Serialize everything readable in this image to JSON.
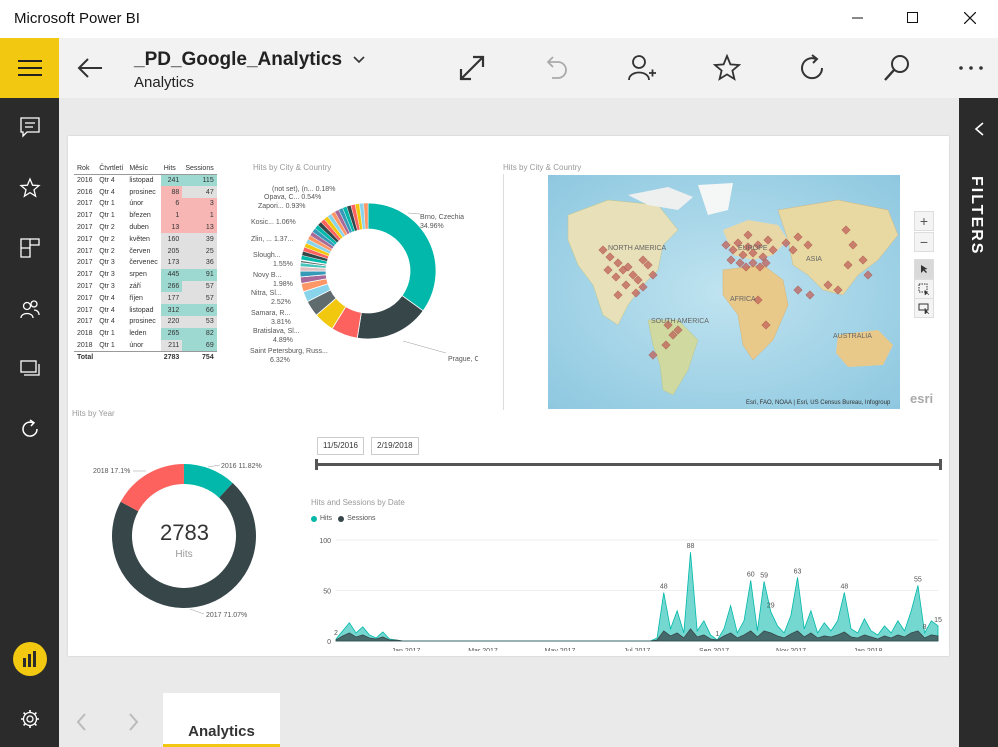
{
  "window": {
    "title": "Microsoft Power BI",
    "minimize_icon": "minimize-icon",
    "maximize_icon": "maximize-icon",
    "close_icon": "close-icon"
  },
  "topbar": {
    "dashboard_name": "_PD_Google_Analytics",
    "subtitle": "Analytics",
    "buttons": [
      "back-icon",
      "expand-icon",
      "undo-icon",
      "add-person-icon",
      "star-icon",
      "refresh-icon",
      "search-icon",
      "more-icon"
    ]
  },
  "nav": {
    "items": [
      "hamburger-icon",
      "comment-icon",
      "star-icon",
      "dashboard-icon",
      "people-icon",
      "devices-icon",
      "refresh-icon",
      "powerbi-icon",
      "settings-icon"
    ]
  },
  "filters": {
    "label": "FILTERS"
  },
  "tabs": [
    {
      "label": "Analytics",
      "active": true
    }
  ],
  "matrix": {
    "headers": [
      "Rok",
      "Čtvrtletí",
      "Měsíc",
      "Hits",
      "Sessions"
    ],
    "rows": [
      [
        "2016",
        "Qtr 4",
        "listopad",
        "241",
        "115"
      ],
      [
        "2016",
        "Qtr 4",
        "prosinec",
        "88",
        "47"
      ],
      [
        "2017",
        "Qtr 1",
        "únor",
        "6",
        "3"
      ],
      [
        "2017",
        "Qtr 1",
        "březen",
        "1",
        "1"
      ],
      [
        "2017",
        "Qtr 2",
        "duben",
        "13",
        "13"
      ],
      [
        "2017",
        "Qtr 2",
        "květen",
        "160",
        "39"
      ],
      [
        "2017",
        "Qtr 2",
        "červen",
        "205",
        "25"
      ],
      [
        "2017",
        "Qtr 3",
        "červenec",
        "173",
        "36"
      ],
      [
        "2017",
        "Qtr 3",
        "srpen",
        "445",
        "91"
      ],
      [
        "2017",
        "Qtr 3",
        "září",
        "266",
        "57"
      ],
      [
        "2017",
        "Qtr 4",
        "říjen",
        "177",
        "57"
      ],
      [
        "2017",
        "Qtr 4",
        "listopad",
        "312",
        "66"
      ],
      [
        "2017",
        "Qtr 4",
        "prosinec",
        "220",
        "53"
      ],
      [
        "2018",
        "Qtr 1",
        "leden",
        "265",
        "82"
      ],
      [
        "2018",
        "Qtr 1",
        "únor",
        "211",
        "69"
      ]
    ],
    "total": [
      "Total",
      "",
      "",
      "2783",
      "754"
    ],
    "colors": {
      "high": "#9ed9d1",
      "mid": "#e0e0e0",
      "low": "#f7b6b3"
    }
  },
  "donut_city": {
    "title": "Hits by City & Country",
    "labels": [
      "Brno, Czechia 34.96%",
      "Prague, Czechia 17.57%",
      "Saint Petersburg, Russ... 6.32%",
      "Bratislava, Sl... 4.89%",
      "Samara, R... 3.81%",
      "Nitra, Sl... 2.52%",
      "Novy B... 1.98%",
      "Slough... 1.55%",
      "Zlin, ... 1.37...",
      "Kosic... 1.06%",
      "Zapori... 0.93%",
      "Opava, C... 0.54%",
      "(not set), (n... 0.18%"
    ]
  },
  "map": {
    "title": "Hits by City & Country",
    "continents": [
      "NORTH AMERICA",
      "SOUTH AMERICA",
      "EUROPE",
      "AFRICA",
      "ASIA",
      "AUSTRALIA"
    ],
    "attribution": "Esri, FAO, NOAA | Esri, US Census Bureau, Infogroup",
    "logo": "esri",
    "zoom_in": "+",
    "zoom_out": "−"
  },
  "year_donut": {
    "title": "Hits by Year",
    "center_value": "2783",
    "center_label": "Hits",
    "labels": [
      "2016 11.82%",
      "2017 71.07%",
      "2018 17.1%"
    ],
    "colors": [
      "#01b8aa",
      "#374649",
      "#fd625e"
    ]
  },
  "date_slicer": {
    "start": "11/5/2016",
    "end": "2/19/2018"
  },
  "chart_data": {
    "type": "area",
    "title": "Hits and Sessions by Date",
    "legend": [
      "Hits",
      "Sessions"
    ],
    "legend_position": "top-left",
    "colors": [
      "#01b8aa",
      "#374649"
    ],
    "y_ticks": [
      "100",
      "50",
      "0"
    ],
    "ylim": [
      0,
      100
    ],
    "x_ticks": [
      "Jan 2017",
      "Mar 2017",
      "May 2017",
      "Jul 2017",
      "Sep 2017",
      "Nov 2017",
      "Jan 2018"
    ],
    "annotations": [
      "2",
      "48",
      "88",
      "1",
      "60",
      "59",
      "29",
      "63",
      "48",
      "55",
      "8",
      "15"
    ],
    "hits": [
      2,
      10,
      18,
      8,
      14,
      6,
      3,
      9,
      2,
      1,
      0,
      0,
      0,
      0,
      0,
      0,
      0,
      0,
      0,
      0,
      0,
      0,
      0,
      0,
      0,
      0,
      0,
      0,
      0,
      0,
      0,
      0,
      0,
      0,
      0,
      0,
      0,
      0,
      0,
      0,
      0,
      0,
      0,
      0,
      0,
      0,
      0,
      0,
      3,
      48,
      12,
      30,
      8,
      88,
      10,
      20,
      6,
      1,
      12,
      35,
      8,
      20,
      60,
      10,
      59,
      29,
      15,
      8,
      25,
      63,
      12,
      30,
      8,
      18,
      10,
      20,
      48,
      12,
      8,
      22,
      10,
      6,
      15,
      8,
      20,
      10,
      30,
      55,
      8,
      20,
      15
    ],
    "sessions": [
      1,
      5,
      8,
      4,
      6,
      3,
      2,
      4,
      1,
      1,
      0,
      0,
      0,
      0,
      0,
      0,
      0,
      0,
      0,
      0,
      0,
      0,
      0,
      0,
      0,
      0,
      0,
      0,
      0,
      0,
      0,
      0,
      0,
      0,
      0,
      0,
      0,
      0,
      0,
      0,
      0,
      0,
      0,
      0,
      0,
      0,
      0,
      0,
      1,
      10,
      5,
      8,
      3,
      12,
      4,
      6,
      2,
      1,
      5,
      8,
      3,
      6,
      10,
      4,
      10,
      8,
      5,
      3,
      7,
      10,
      4,
      8,
      3,
      5,
      4,
      6,
      9,
      4,
      3,
      6,
      4,
      2,
      5,
      3,
      6,
      4,
      8,
      10,
      3,
      6,
      5
    ]
  }
}
